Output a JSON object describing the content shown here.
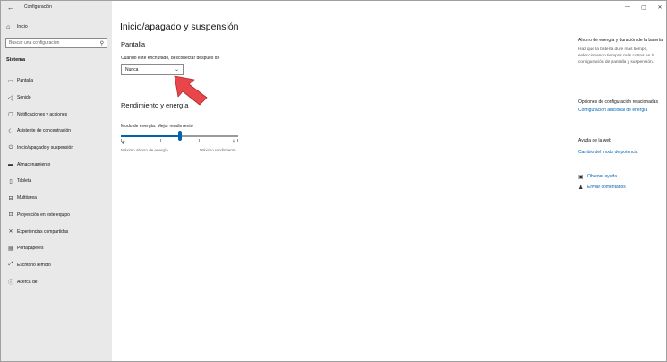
{
  "window": {
    "app_title": "Configuración",
    "controls": {
      "minimize": "—",
      "maximize": "▢",
      "close": "✕"
    }
  },
  "sidebar": {
    "home_label": "Inicio",
    "search_placeholder": "Buscar una configuración",
    "section": "Sistema",
    "items": [
      {
        "icon": "monitor-icon",
        "label": "Pantalla"
      },
      {
        "icon": "speaker-icon",
        "label": "Sonido"
      },
      {
        "icon": "notifications-icon",
        "label": "Notificaciones y acciones"
      },
      {
        "icon": "moon-icon",
        "label": "Asistente de concentración"
      },
      {
        "icon": "power-icon",
        "label": "Inicio/apagado y suspensión"
      },
      {
        "icon": "storage-icon",
        "label": "Almacenamiento"
      },
      {
        "icon": "tablet-icon",
        "label": "Tableta"
      },
      {
        "icon": "multitask-icon",
        "label": "Multitarea"
      },
      {
        "icon": "projection-icon",
        "label": "Proyección en este equipo"
      },
      {
        "icon": "shared-icon",
        "label": "Experiencias compartidas"
      },
      {
        "icon": "clipboard-icon",
        "label": "Portapapeles"
      },
      {
        "icon": "remote-desktop-icon",
        "label": "Escritorio remoto"
      },
      {
        "icon": "info-icon",
        "label": "Acerca de"
      }
    ]
  },
  "main": {
    "title": "Inicio/apagado y suspensión",
    "screen_heading": "Pantalla",
    "plugged_label": "Cuando esté enchufado, desconectar después de",
    "dropdown_value": "Nunca",
    "performance_heading": "Rendimiento y energía",
    "mode_label": "Modo de energía: Mejor rendimiento",
    "slider_level": 0.5,
    "slider_min_label": "Máximo ahorro de energía",
    "slider_max_label": "Máximo rendimiento"
  },
  "right_panel": {
    "battery_heading": "Ahorro de energía y duración de la batería",
    "battery_text": "Haz que la batería dure más tiempo, seleccionando tiempos más cortos en la configuración de pantalla y suspensión.",
    "related_heading": "Opciones de configuración relacionadas",
    "related_link": "Configuración adicional de energía",
    "web_help_heading": "Ayuda de la web",
    "web_help_link": "Cambio del modo de potencia",
    "get_help": "Obtener ayuda",
    "feedback": "Enviar comentarios"
  },
  "colors": {
    "accent": "#0063b1",
    "sidebar_bg": "#e9e9e9",
    "arrow": "#e8464a"
  }
}
